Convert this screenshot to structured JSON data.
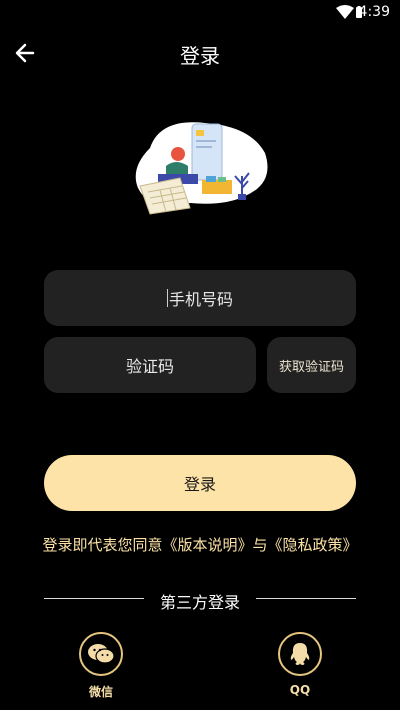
{
  "status_bar": {
    "time": "4:39",
    "icons": [
      "wifi-icon",
      "battery-icon"
    ]
  },
  "header": {
    "title": "登录",
    "back_icon": "arrow-left-icon"
  },
  "illustration": {
    "icon": "login-illustration"
  },
  "form": {
    "phone_placeholder": "手机号码",
    "code_placeholder": "验证码",
    "get_code_label": "获取验证码",
    "login_label": "登录"
  },
  "agreement": {
    "prefix": "登录即代表您同意",
    "version_link": "《版本说明》",
    "conjunction": "与",
    "privacy_link": "《隐私政策》"
  },
  "third_party": {
    "title": "第三方登录",
    "providers": [
      {
        "label": "微信",
        "icon": "wechat-icon"
      },
      {
        "label": "QQ",
        "icon": "qq-icon"
      }
    ]
  },
  "colors": {
    "background": "#000000",
    "accent": "#fde3a7",
    "field": "#222222",
    "link": "#fbe1a4"
  }
}
